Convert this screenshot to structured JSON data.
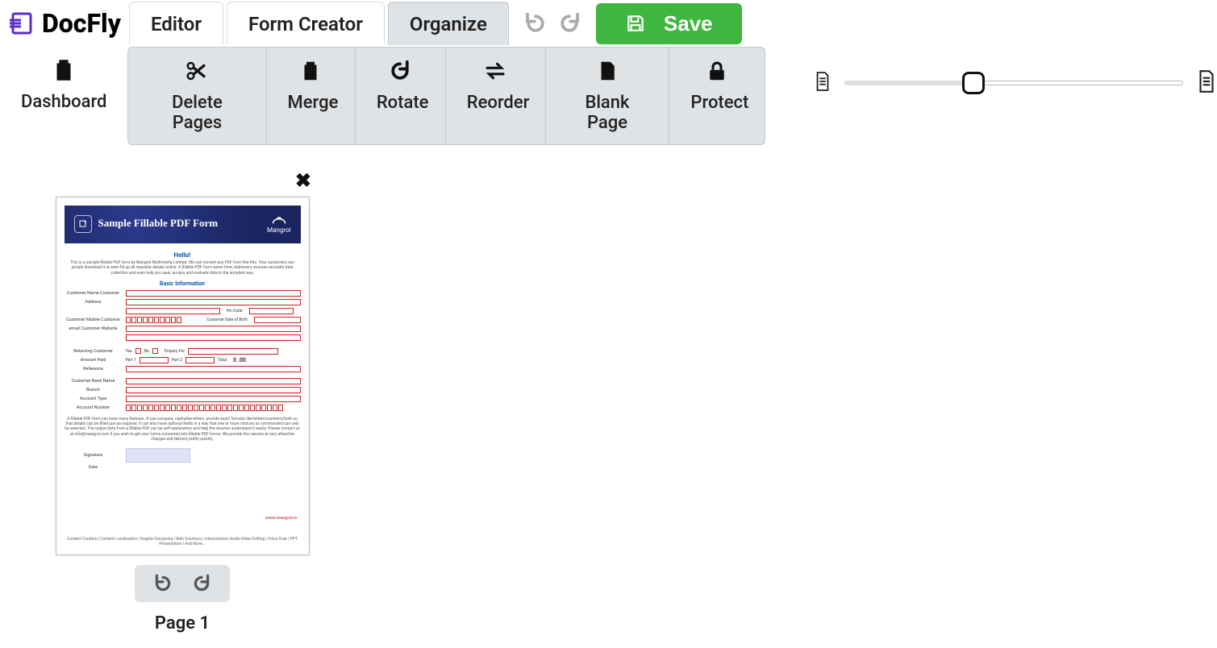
{
  "brand": {
    "name": "DocFly"
  },
  "tabs": {
    "editor": "Editor",
    "form_creator": "Form Creator",
    "organize": "Organize"
  },
  "buttons": {
    "save": "Save"
  },
  "nav": {
    "dashboard": "Dashboard"
  },
  "tools": {
    "delete_pages": "Delete Pages",
    "merge": "Merge",
    "rotate": "Rotate",
    "reorder": "Reorder",
    "blank_page": "Blank Page",
    "protect": "Protect"
  },
  "zoom": {
    "value": 35,
    "min": 0,
    "max": 100
  },
  "page": {
    "label": "Page 1",
    "title": "Sample Fillable PDF Form",
    "brand_small": "Mangrol",
    "hello": "Hello!",
    "intro": "This is a sample fillable PDF form by Mangrol Multimedia Limited. We can convert any PDF form like this. Your customers can simply download it or even fill up all requisite details online. A fillable PDF form saves time, stationery, ensures accurate data collection and even help you save, access and evaluate data in the simplest way.",
    "section_basic": "Basic Information",
    "labels": {
      "customer_name": "Customer Name Customer",
      "address": "Address",
      "pin_code": "Pin Code",
      "mobile": "Customer Mobile  Customer",
      "email": "email Customer Website",
      "dob": "Customer Date of Birth",
      "returning": "Returning Customer",
      "yes": "Yes",
      "no": "No",
      "enquiry": "Enquiry For",
      "amount_paid": "Amount Paid",
      "part1": "Part 1",
      "part2": "Part 2",
      "total": "Total",
      "total_val": "0 .00",
      "reference": "Reference",
      "bank_name": "Customer Bank Name",
      "branch": "Branch",
      "account_type": "Account Type",
      "account_number": "Account Number",
      "signature": "Signature",
      "date": "Date",
      "link": "www.mangrol.in"
    },
    "para2": "A fillable PDF form can have many features. It can compute, capitalize letters, provide exact formats like letters/numbers/both so that details can be filled just as required. It can also have optional fields in a way that one or more choices as commanded can only be selected. The output data from a fillable PDF can be self-explanatory and help the receiver understand it easily. Please contact us at info@mangrol.com if you wish to get your forms converted into fillable PDF forms. We provide this service at very attractive charges and delivery pretty quickly.",
    "footer": "Content Creation  |  Content Localisation  |  Graphic Designing  |  Web Solutions  |  Interpretation\nAudio-Video Editing  |  Voice-Over  |  PPT Presentation  |  And More..."
  }
}
